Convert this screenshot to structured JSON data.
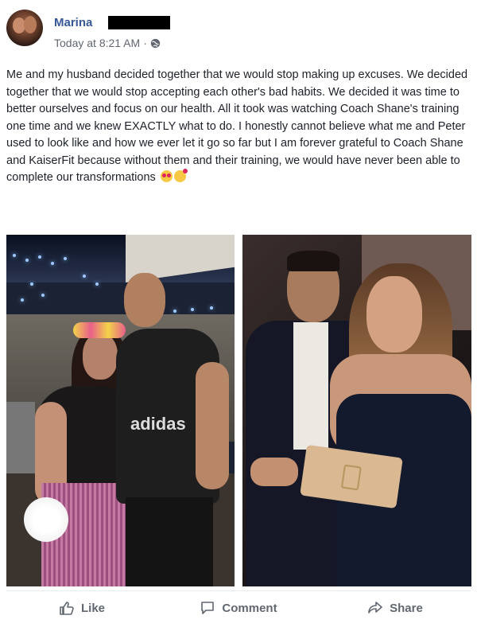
{
  "post": {
    "author": "Marina",
    "timestamp": "Today at 8:21 AM",
    "separator": "·",
    "privacy_icon": "globe-icon",
    "text": "Me and my husband decided together that we would stop making up excuses. We decided together that we would stop accepting each other's bad habits. We decided it was time to better ourselves and focus on our health. All it took was watching Coach Shane's training one time and we knew EXACTLY what to do. I honestly cannot believe what me and Peter used to look like and how we ever let it go so far but I am forever grateful to Coach Shane and KaiserFit because without them and their training, we would have never been able to complete our transformations",
    "emojis": [
      "smiling-face-with-heart-eyes",
      "smiling-face-with-hearts"
    ],
    "photos": {
      "left_shirt_text": "adidas"
    }
  },
  "actions": {
    "like_label": "Like",
    "comment_label": "Comment",
    "share_label": "Share"
  },
  "colors": {
    "name_link": "#365899",
    "meta_gray": "#616770",
    "action_gray": "#606770",
    "text": "#1d2129"
  }
}
